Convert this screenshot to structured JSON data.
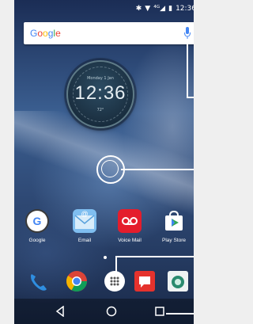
{
  "status_bar": {
    "time": "12:36",
    "icons": [
      "bluetooth-icon",
      "wifi-icon",
      "signal-4g-icon",
      "battery-icon"
    ]
  },
  "search_bar": {
    "logo": "Google",
    "mic_icon": "mic-icon"
  },
  "clock_widget": {
    "time": "12:36",
    "date_small": "Monday 1 Jan",
    "weather_small": "72°"
  },
  "apps": [
    {
      "label": "Google",
      "icon": "google-icon",
      "color": "#3a3a3a"
    },
    {
      "label": "Email",
      "icon": "email-icon",
      "color": "#7fbef0"
    },
    {
      "label": "Voice Mail",
      "icon": "voicemail-icon",
      "color": "#e41d2c"
    },
    {
      "label": "Play Store",
      "icon": "play-store-icon",
      "color": "#ffffff"
    }
  ],
  "dock": [
    {
      "name": "phone-icon",
      "color": "#2f8ee0"
    },
    {
      "name": "chrome-icon",
      "color": "#ffffff"
    },
    {
      "name": "app-drawer-icon",
      "color": "#ffffff"
    },
    {
      "name": "messages-icon",
      "color": "#e5322d"
    },
    {
      "name": "camera-icon",
      "color": "#ffffff"
    }
  ],
  "nav_bar": {
    "back": "back-icon",
    "home": "home-icon",
    "recents": "recents-icon"
  }
}
